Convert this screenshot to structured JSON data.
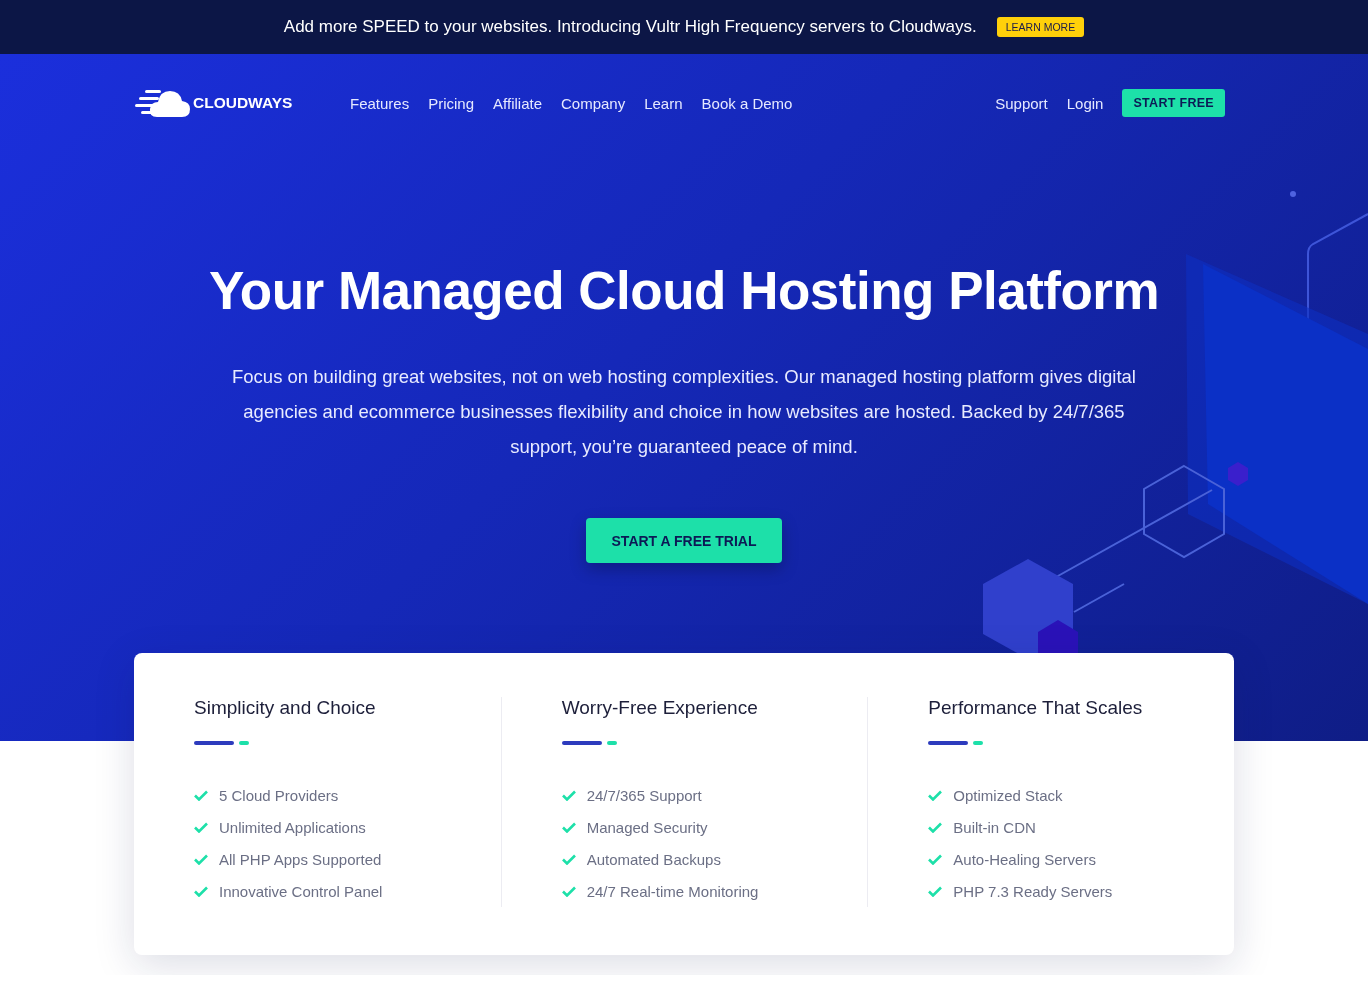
{
  "announcement": {
    "text": "Add more SPEED to your websites. Introducing Vultr High Frequency servers to Cloudways.",
    "button": "LEARN MORE"
  },
  "nav": {
    "logo_text": "CLOUDWAYS",
    "links": [
      "Features",
      "Pricing",
      "Affiliate",
      "Company",
      "Learn",
      "Book a Demo"
    ],
    "right_links": [
      "Support",
      "Login"
    ],
    "cta": "START FREE"
  },
  "hero": {
    "title": "Your Managed Cloud Hosting Platform",
    "description": "Focus on building great websites, not on web hosting complexities. Our managed hosting platform gives digital agencies and ecommerce businesses flexibility and choice in how websites are hosted. Backed by 24/7/365 support, you’re guaranteed peace of mind.",
    "button": "START A FREE TRIAL"
  },
  "features": [
    {
      "title": "Simplicity and Choice",
      "items": [
        "5 Cloud Providers",
        "Unlimited Applications",
        "All PHP Apps Supported",
        "Innovative Control Panel"
      ]
    },
    {
      "title": "Worry-Free Experience",
      "items": [
        "24/7/365 Support",
        "Managed Security",
        "Automated Backups",
        "24/7 Real-time Monitoring"
      ]
    },
    {
      "title": "Performance That Scales",
      "items": [
        "Optimized Stack",
        "Built-in CDN",
        "Auto-Healing Servers",
        "PHP 7.3 Ready Servers"
      ]
    }
  ]
}
